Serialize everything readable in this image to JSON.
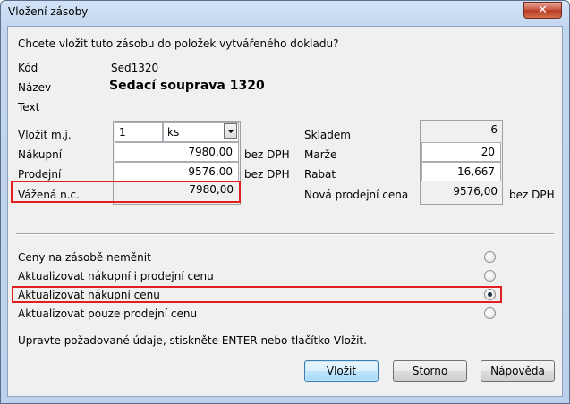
{
  "window": {
    "title": "Vložení zásoby",
    "close_symbol": "✕"
  },
  "question": "Chcete vložit tuto zásobu do položek vytvářeného dokladu?",
  "item": {
    "kod_label": "Kód",
    "kod_value": "Sed1320",
    "nazev_label": "Název",
    "nazev_value": "Sedací souprava 1320",
    "text_label": "Text"
  },
  "left_fields": {
    "vlozit_label": "Vložit m.j.",
    "vlozit_qty": "1",
    "vlozit_unit": "ks",
    "nakupni_label": "Nákupní",
    "nakupni_value": "7980,00",
    "nakupni_suffix": "bez DPH",
    "prodejni_label": "Prodejní",
    "prodejni_value": "9576,00",
    "prodejni_suffix": "bez DPH",
    "vazena_label": "Vážená n.c.",
    "vazena_value": "7980,00"
  },
  "right_fields": {
    "skladem_label": "Skladem",
    "skladem_value": "6",
    "marze_label": "Marže",
    "marze_value": "20",
    "rabat_label": "Rabat",
    "rabat_value": "16,667",
    "nova_label": "Nová prodejní cena",
    "nova_value": "9576,00",
    "nova_suffix": "bez DPH"
  },
  "options": [
    {
      "label": "Ceny na zásobě neměnit",
      "selected": false
    },
    {
      "label": "Aktualizovat nákupní i prodejní cenu",
      "selected": false
    },
    {
      "label": "Aktualizovat nákupní cenu",
      "selected": true
    },
    {
      "label": "Aktualizovat pouze prodejní cenu",
      "selected": false
    }
  ],
  "hint": "Upravte požadované údaje, stiskněte ENTER nebo tlačítko Vložit.",
  "buttons": {
    "insert": "Vložit",
    "cancel": "Storno",
    "help": "Nápověda"
  },
  "colors": {
    "highlight_border": "#e02020"
  }
}
